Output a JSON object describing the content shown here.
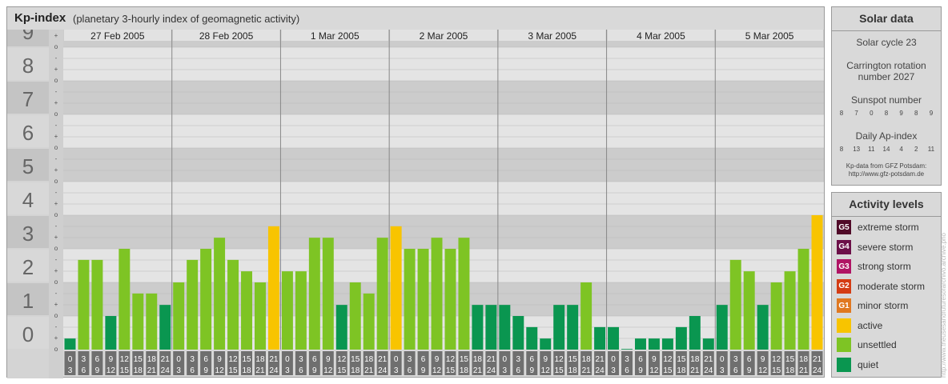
{
  "header": {
    "title": "Kp-index",
    "subtitle": "(planetary 3-hourly index of geomagnetic activity)"
  },
  "colors": {
    "quiet": "#0a9650",
    "unsettled": "#7ec424",
    "active": "#f8c400",
    "g1": "#e07820",
    "g2": "#d43c14",
    "g3": "#b01464",
    "g4": "#6c1048",
    "g5": "#500a28"
  },
  "chart_data": {
    "type": "bar",
    "title": "Kp-index",
    "days": [
      "27 Feb 2005",
      "28 Feb 2005",
      "1 Mar 2005",
      "2 Mar 2005",
      "3 Mar 2005",
      "4 Mar 2005",
      "5 Mar 2005"
    ],
    "interval_start": [
      "0",
      "3",
      "6",
      "9",
      "12",
      "15",
      "18",
      "21"
    ],
    "interval_end": [
      "3",
      "6",
      "9",
      "12",
      "15",
      "18",
      "21",
      "24"
    ],
    "y_ticks": [
      "0",
      "1",
      "2",
      "3",
      "4",
      "5",
      "6",
      "7",
      "8",
      "9"
    ],
    "sub_ticks": [
      "o",
      "+",
      "-"
    ],
    "ylim": [
      0,
      9.33
    ],
    "grid": true,
    "values": [
      0.33,
      2.67,
      2.67,
      1.0,
      3.0,
      1.67,
      1.67,
      1.33,
      2.0,
      2.67,
      3.0,
      3.33,
      2.67,
      2.33,
      2.0,
      3.67,
      2.33,
      2.33,
      3.33,
      3.33,
      1.33,
      2.0,
      1.67,
      3.33,
      3.67,
      3.0,
      3.0,
      3.33,
      3.0,
      3.33,
      1.33,
      1.33,
      1.33,
      1.0,
      0.67,
      0.33,
      1.33,
      1.33,
      2.0,
      0.67,
      0.67,
      0.0,
      0.33,
      0.33,
      0.33,
      0.67,
      1.0,
      0.33,
      1.33,
      2.67,
      2.33,
      1.33,
      2.0,
      2.33,
      3.0,
      4.0
    ]
  },
  "solar": {
    "title": "Solar data",
    "cycle": "Solar cycle 23",
    "carrington_line1": "Carrington rotation",
    "carrington_line2": "number 2027",
    "sunspot_label": "Sunspot number",
    "sunspot_values": [
      "8",
      "7",
      "0",
      "8",
      "9",
      "8",
      "9"
    ],
    "ap_label": "Daily Ap-index",
    "ap_values": [
      "8",
      "13",
      "11",
      "14",
      "4",
      "2",
      "11"
    ],
    "source_line1": "Kp-data from GFZ Potsdam:",
    "source_line2": "http://www.gfz-potsdam.de"
  },
  "activity": {
    "title": "Activity levels",
    "items": [
      {
        "badge": "G5",
        "label": "extreme storm",
        "color": "#500a28"
      },
      {
        "badge": "G4",
        "label": "severe storm",
        "color": "#6c1048"
      },
      {
        "badge": "G3",
        "label": "strong storm",
        "color": "#b01464"
      },
      {
        "badge": "G2",
        "label": "moderate storm",
        "color": "#d43c14"
      },
      {
        "badge": "G1",
        "label": "minor storm",
        "color": "#e07820"
      },
      {
        "badge": "",
        "label": "active",
        "color": "#f8c400"
      },
      {
        "badge": "",
        "label": "unsettled",
        "color": "#7ec424"
      },
      {
        "badge": "",
        "label": "quiet",
        "color": "#0a9650"
      }
    ]
  },
  "watermark": "http://www.theusesandfuturesofarchivo.archive.pho"
}
